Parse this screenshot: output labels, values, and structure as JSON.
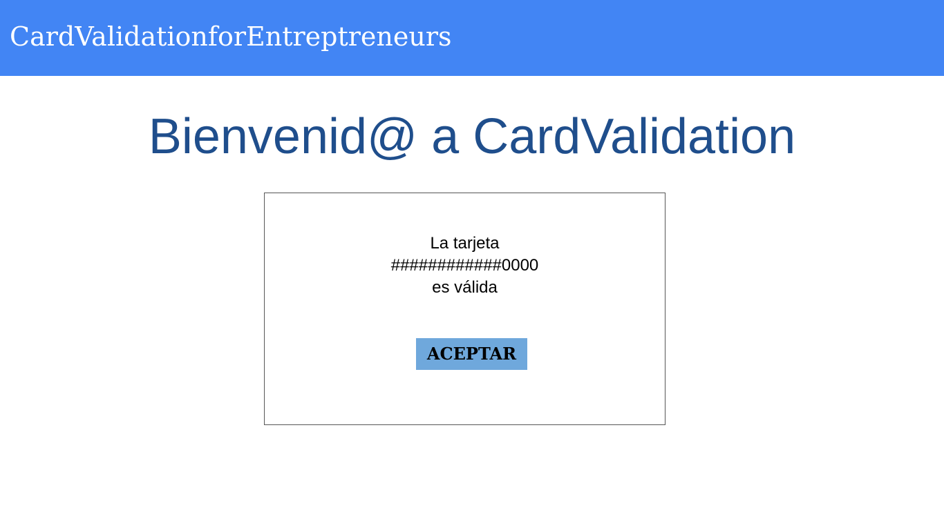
{
  "header": {
    "title": "CardValidationforEntreptreneurs",
    "background_color": "#4285f4"
  },
  "main": {
    "welcome": "Bienvenid@ a CardValidation",
    "welcome_color": "#1f4e8c"
  },
  "dialog": {
    "line_1": "La tarjeta",
    "masked_card": "############0000",
    "line_3": "es válida",
    "accept_label": "ACEPTAR",
    "accept_color": "#6fa8dc"
  }
}
